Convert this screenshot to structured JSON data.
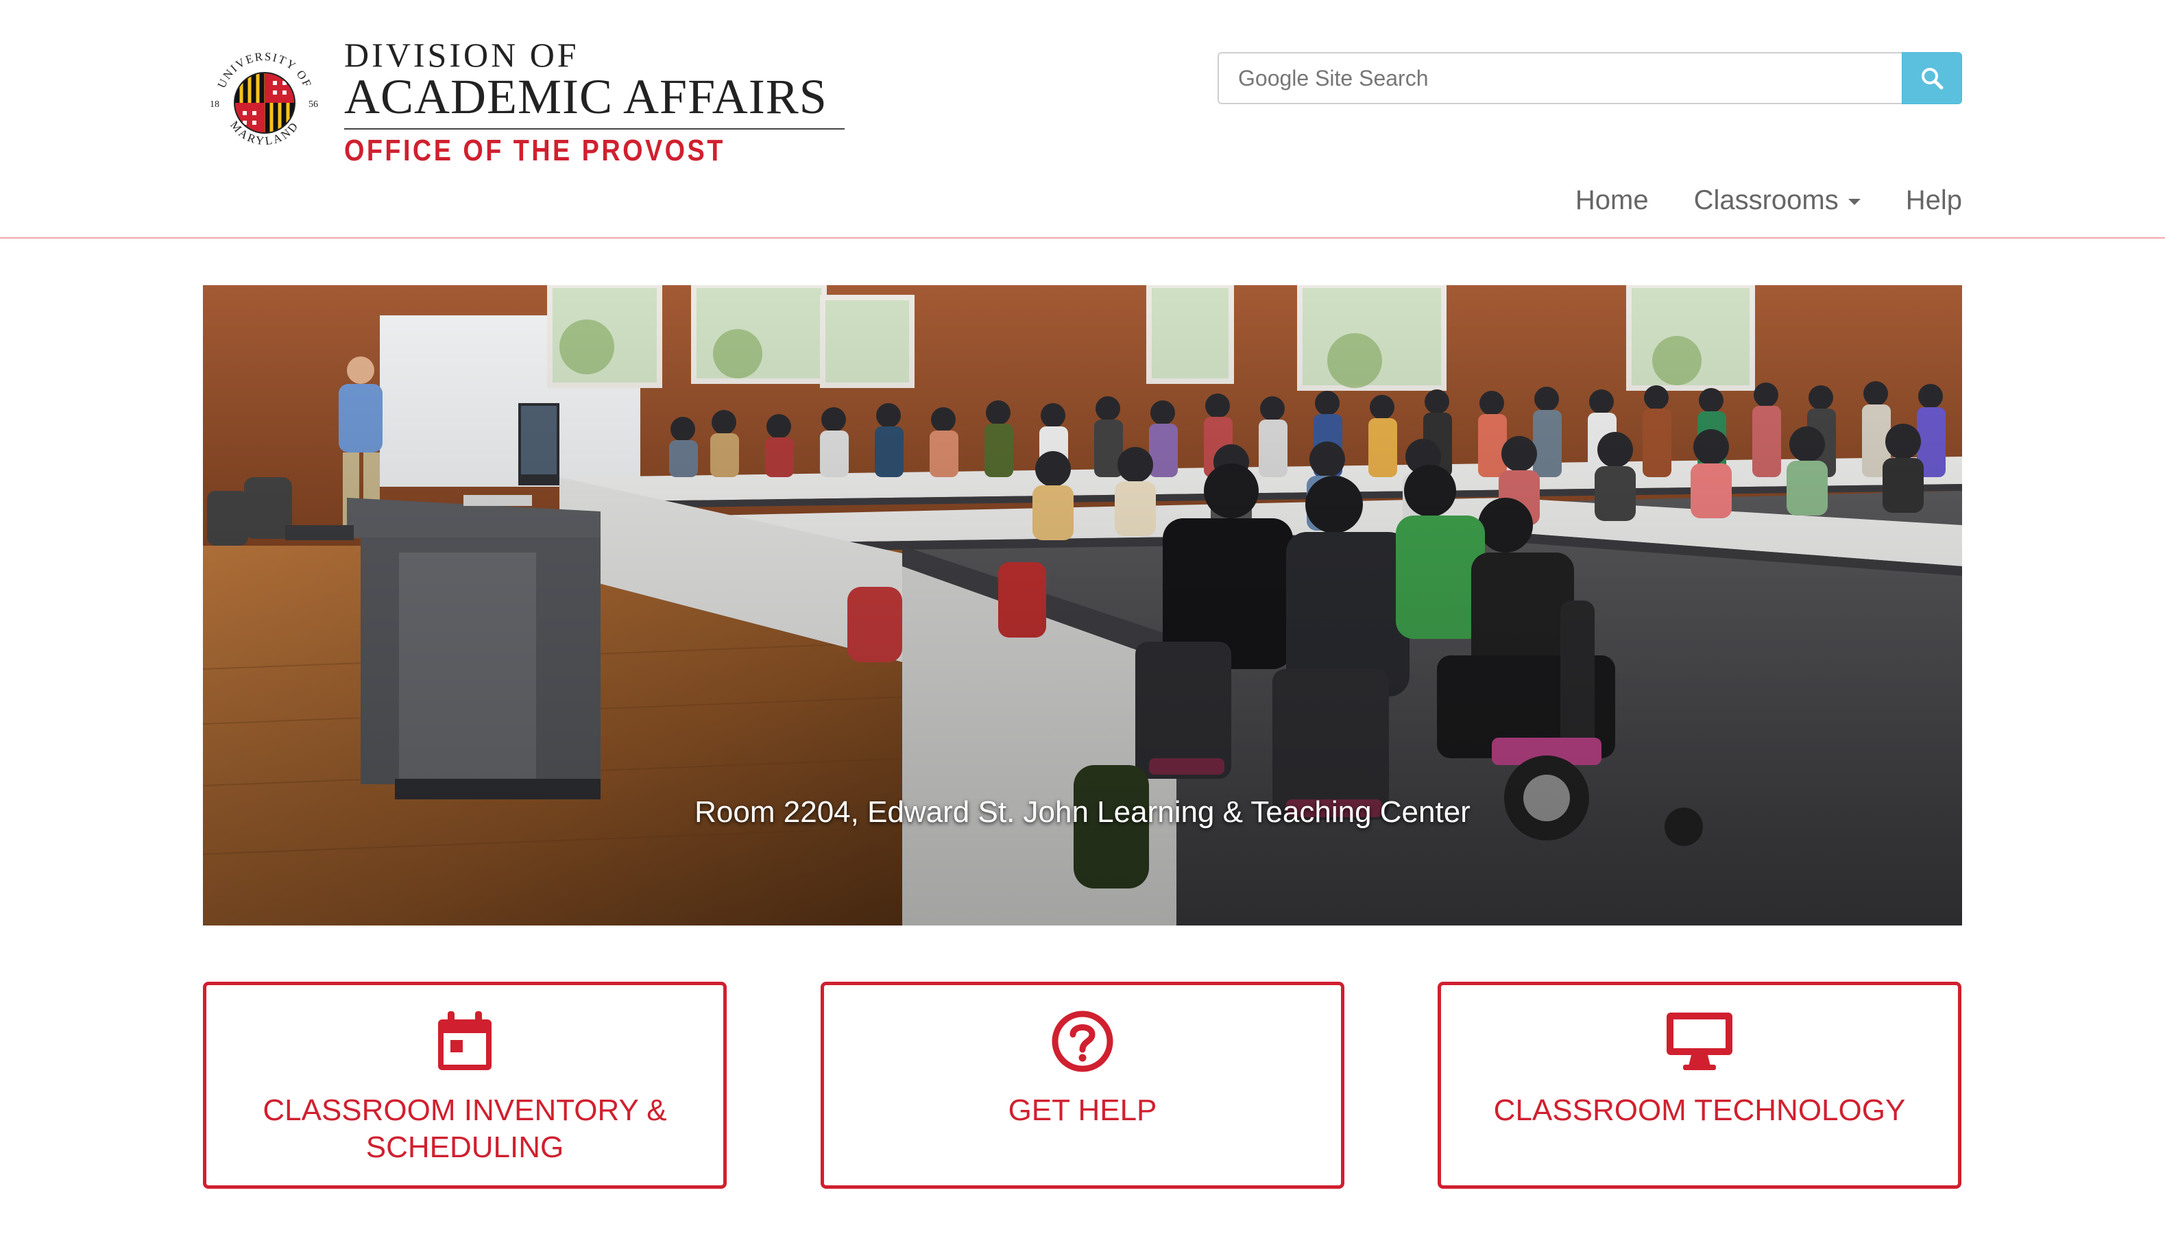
{
  "brand": {
    "seal_text_top": "UNIVERSITY OF",
    "seal_text_bottom": "MARYLAND",
    "seal_year_left": "18",
    "seal_year_right": "56",
    "line1": "DIVISION OF",
    "line2": "ACADEMIC AFFAIRS",
    "line3": "OFFICE OF THE PROVOST",
    "colors": {
      "red": "#d0202f",
      "gold": "#f7c31b",
      "black": "#111111"
    }
  },
  "search": {
    "placeholder": "Google Site Search",
    "button_icon": "search-icon",
    "button_color": "#5bc0de"
  },
  "nav": {
    "items": [
      {
        "label": "Home"
      },
      {
        "label": "Classrooms",
        "has_dropdown": true
      },
      {
        "label": "Help"
      }
    ]
  },
  "hero": {
    "caption": "Room 2204, Edward St. John Learning & Teaching Center"
  },
  "cards": [
    {
      "title": "CLASSROOM INVENTORY & SCHEDULING",
      "icon": "calendar-icon"
    },
    {
      "title": "GET HELP",
      "icon": "question-circle-icon"
    },
    {
      "title": "CLASSROOM TECHNOLOGY",
      "icon": "monitor-icon"
    }
  ],
  "accent_color": "#d0202f"
}
